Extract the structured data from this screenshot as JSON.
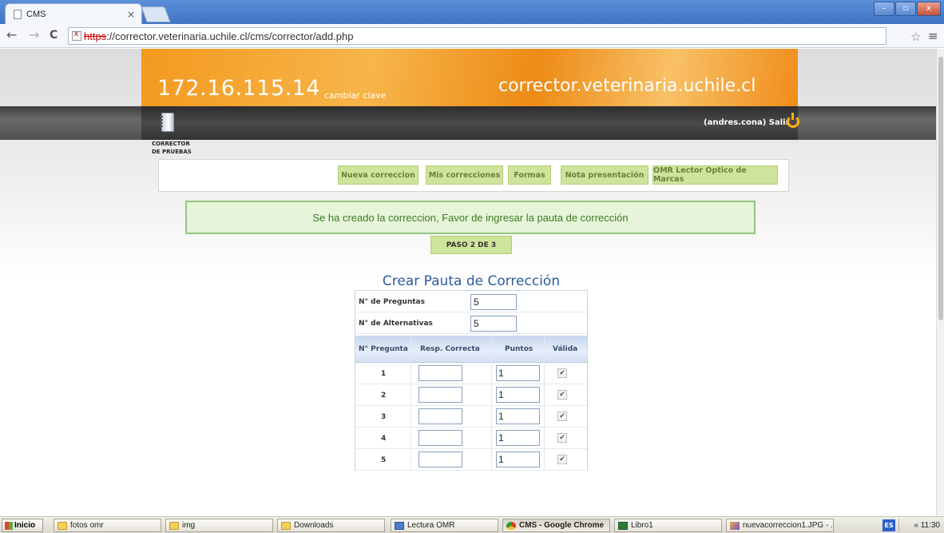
{
  "browser": {
    "tab_title": "CMS",
    "tab_close": "×",
    "url_protocol": "https",
    "url_rest": "://corrector.veterinaria.uchile.cl/cms/corrector/add.php",
    "back_icon": "←",
    "forward_icon": "→",
    "reload_icon": "C",
    "star_icon": "☆",
    "menu_icon": "≡",
    "window_controls": [
      "–",
      "▫",
      "x"
    ]
  },
  "header": {
    "ip": "172.16.115.14",
    "change_password": "cambiar clave",
    "domain": "corrector.veterinaria.uchile.cl",
    "user": "(andres.cona)",
    "logout": "Salir",
    "brand_line1": "CORRECTOR",
    "brand_line2": "DE PRUEBAS"
  },
  "nav": {
    "items": [
      {
        "label": "Nueva correccion"
      },
      {
        "label": "Mis correcciones"
      },
      {
        "label": "Formas"
      },
      {
        "label": "Nota presentación"
      },
      {
        "label": "OMR Lector Optico de Marcas"
      }
    ]
  },
  "message": "Se ha creado la correccion, Favor de ingresar la pauta de corrección",
  "step": "PASO 2 DE 3",
  "form": {
    "title": "Crear Pauta de Corrección",
    "num_questions_label": "N° de Preguntas",
    "num_questions_value": "5",
    "num_alternatives_label": "N° de Alternativas",
    "num_alternatives_value": "5",
    "columns": [
      "N° Pregunta",
      "Resp. Correcta",
      "Puntos",
      "Válida"
    ],
    "rows": [
      {
        "num": "1",
        "answer": "",
        "points": "1",
        "valid": "✔"
      },
      {
        "num": "2",
        "answer": "",
        "points": "1",
        "valid": "✔"
      },
      {
        "num": "3",
        "answer": "",
        "points": "1",
        "valid": "✔"
      },
      {
        "num": "4",
        "answer": "",
        "points": "1",
        "valid": "✔"
      },
      {
        "num": "5",
        "answer": "",
        "points": "1",
        "valid": "✔"
      }
    ]
  },
  "taskbar": {
    "start": "Inicio",
    "items": [
      {
        "label": "fotos omr",
        "icon": "folder-icon"
      },
      {
        "label": "img",
        "icon": "folder-icon"
      },
      {
        "label": "Downloads",
        "icon": "folder-icon"
      },
      {
        "label": "Lectura OMR",
        "icon": "app-icon"
      },
      {
        "label": "CMS - Google Chrome",
        "icon": "chrome-icon"
      },
      {
        "label": "Libro1",
        "icon": "excel-icon"
      },
      {
        "label": "nuevacorreccion1.JPG - ...",
        "icon": "paint-icon"
      }
    ],
    "lang": "ES",
    "clock": "« 11:30"
  }
}
